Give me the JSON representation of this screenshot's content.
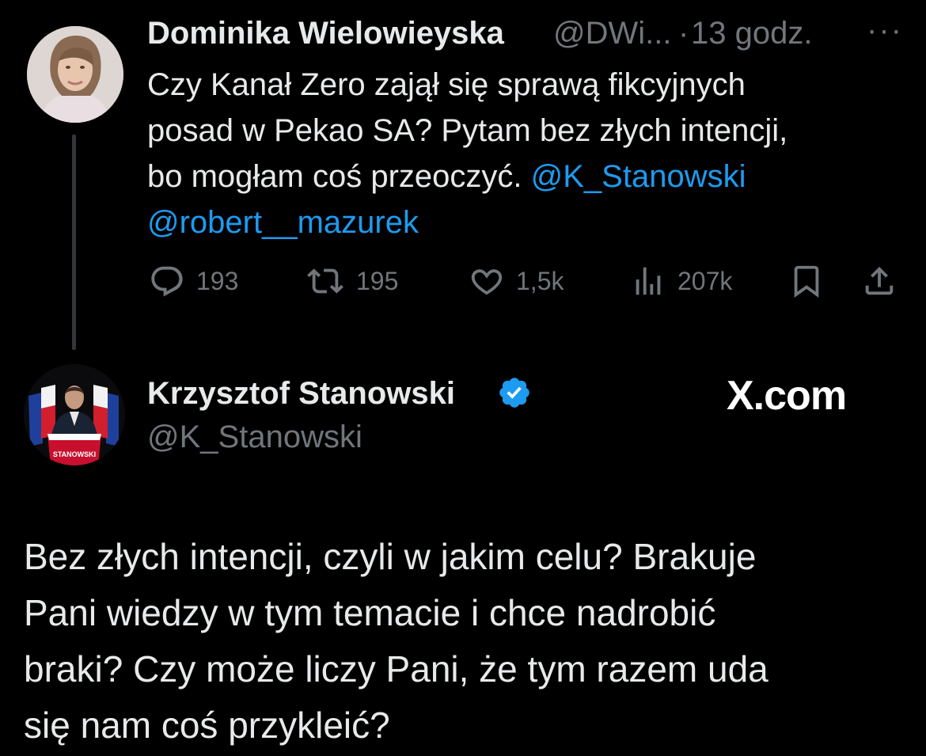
{
  "tweet1": {
    "author_name": "Dominika Wielowieyska",
    "handle": "@DWi...",
    "separator": "·",
    "time": "13 godz.",
    "more_icon": "···",
    "text_lines": [
      "Czy Kanał Zero zajął się sprawą fikcyjnych",
      "posad w Pekao SA? Pytam bez złych intencji,"
    ],
    "line3_text": "bo mogłam coś przeoczyć. ",
    "mention1": "@K_Stanowski",
    "mention2": "@robert__mazurek",
    "actions": {
      "replies": "193",
      "retweets": "195",
      "likes": "1,5k",
      "views": "207k"
    },
    "colors": {
      "mention": "#1d9bf0",
      "secondary": "#71767b"
    }
  },
  "tweet2": {
    "author_name": "Krzysztof Stanowski",
    "handle": "@K_Stanowski",
    "watermark": "X.com",
    "avatar_podium_text": "STANOWSKI",
    "text_lines": [
      "Bez złych intencji, czyli w jakim celu? Brakuje",
      "Pani wiedzy w tym temacie i chce nadrobić",
      "braki? Czy może liczy Pani, że tym razem uda",
      "się nam coś przykleić?"
    ],
    "colors": {
      "verified": "#1d9bf0"
    }
  }
}
